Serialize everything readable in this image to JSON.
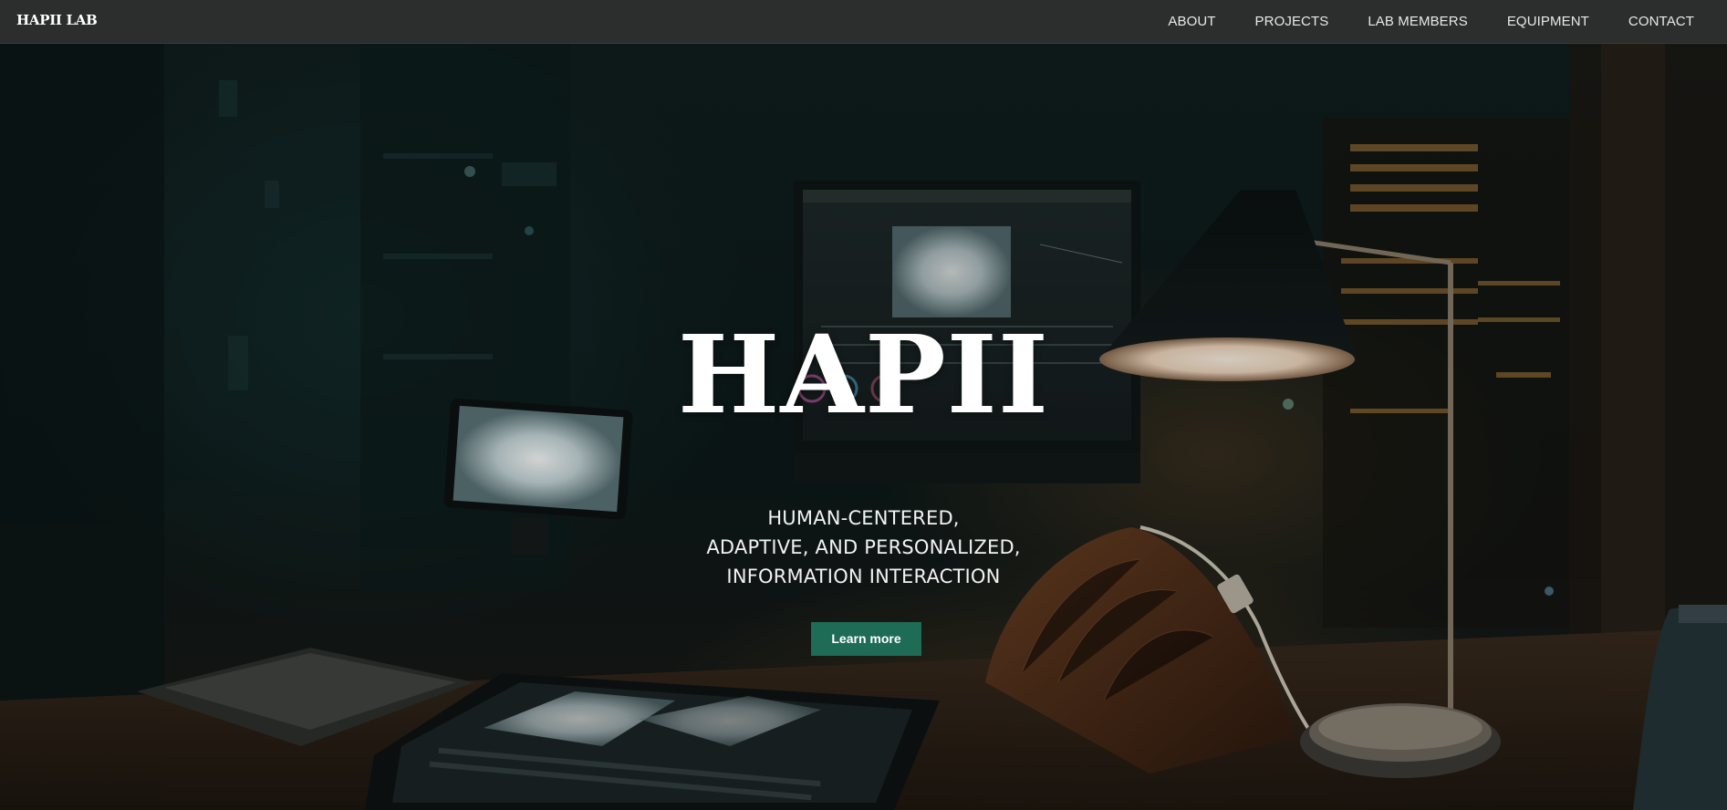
{
  "navbar": {
    "brand": "HAPII LAB",
    "links": [
      {
        "label": "ABOUT"
      },
      {
        "label": "PROJECTS"
      },
      {
        "label": "LAB MEMBERS"
      },
      {
        "label": "EQUIPMENT"
      },
      {
        "label": "CONTACT"
      }
    ]
  },
  "hero": {
    "title": "HAPII",
    "subtitle_lines": [
      "HUMAN-CENTERED,",
      "ADAPTIVE, AND PERSONALIZED,",
      "INFORMATION INTERACTION"
    ],
    "button_label": "Learn more"
  },
  "colors": {
    "navbar_bg": "#2c2e2e",
    "button_bg": "#1e6b56",
    "text": "#ffffff"
  }
}
